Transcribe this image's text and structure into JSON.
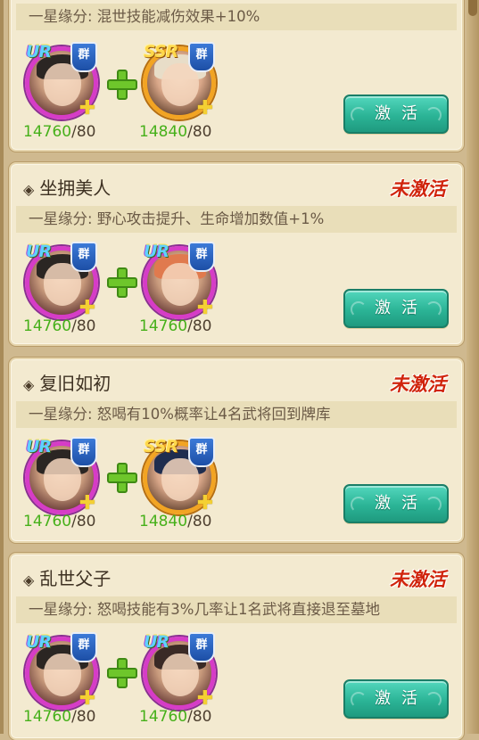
{
  "cards": [
    {
      "title": "",
      "status": "",
      "effect": "一星缘分: 混世技能减伤效果+10%",
      "heroes": [
        {
          "rarity": "UR",
          "faction": "群",
          "have": "14760",
          "need": "/80"
        },
        {
          "rarity": "SSR",
          "faction": "群",
          "have": "14840",
          "need": "/80"
        }
      ],
      "button": "激活"
    },
    {
      "title": "坐拥美人",
      "status": "未激活",
      "effect": "一星缘分: 野心攻击提升、生命增加数值+1%",
      "heroes": [
        {
          "rarity": "UR",
          "faction": "群",
          "have": "14760",
          "need": "/80"
        },
        {
          "rarity": "UR",
          "faction": "群",
          "have": "14760",
          "need": "/80"
        }
      ],
      "button": "激活"
    },
    {
      "title": "复旧如初",
      "status": "未激活",
      "effect": "一星缘分: 怒喝有10%概率让4名武将回到牌库",
      "heroes": [
        {
          "rarity": "UR",
          "faction": "群",
          "have": "14760",
          "need": "/80"
        },
        {
          "rarity": "SSR",
          "faction": "群",
          "have": "14840",
          "need": "/80"
        }
      ],
      "button": "激活"
    },
    {
      "title": "乱世父子",
      "status": "未激活",
      "effect": "一星缘分: 怒喝技能有3%几率让1名武将直接退至墓地",
      "heroes": [
        {
          "rarity": "UR",
          "faction": "群",
          "have": "14760",
          "need": "/80"
        },
        {
          "rarity": "UR",
          "faction": "群",
          "have": "14760",
          "need": "/80"
        }
      ],
      "button": "激活"
    }
  ],
  "icons": {
    "diamond": "◈",
    "plus": "plus-icon",
    "puzzle": "✚",
    "faction_badge": "shield-icon"
  },
  "colors": {
    "ur_ring": "#d63cc7",
    "ssr_ring": "#f2a423",
    "status_red": "#d0240c",
    "button_teal": "#2bb496",
    "fragments_green": "#46b01a"
  }
}
